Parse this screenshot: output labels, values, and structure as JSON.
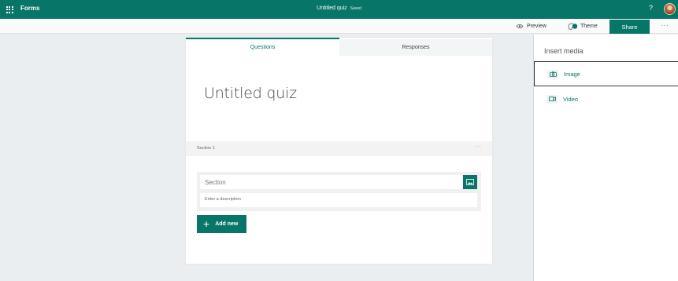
{
  "topbar": {
    "app_name": "Forms",
    "doc_title": "Untitled quiz",
    "saved_status": "Saved",
    "help_label": "?"
  },
  "commandbar": {
    "preview_label": "Preview",
    "theme_label": "Theme",
    "share_label": "Share",
    "more_label": "···"
  },
  "form": {
    "tabs": [
      {
        "label": "Questions",
        "active": true
      },
      {
        "label": "Responses",
        "active": false
      }
    ],
    "title": "Untitled quiz",
    "section": {
      "label": "Section 1",
      "more_label": "···",
      "title_placeholder": "Section",
      "description_placeholder": "Enter a description"
    },
    "add_new_label": "Add new"
  },
  "panel": {
    "title": "Insert media",
    "items": [
      {
        "label": "Image",
        "icon": "camera-icon"
      },
      {
        "label": "Video",
        "icon": "video-icon"
      }
    ]
  },
  "colors": {
    "brand": "#077568",
    "background": "#eaeef0"
  }
}
